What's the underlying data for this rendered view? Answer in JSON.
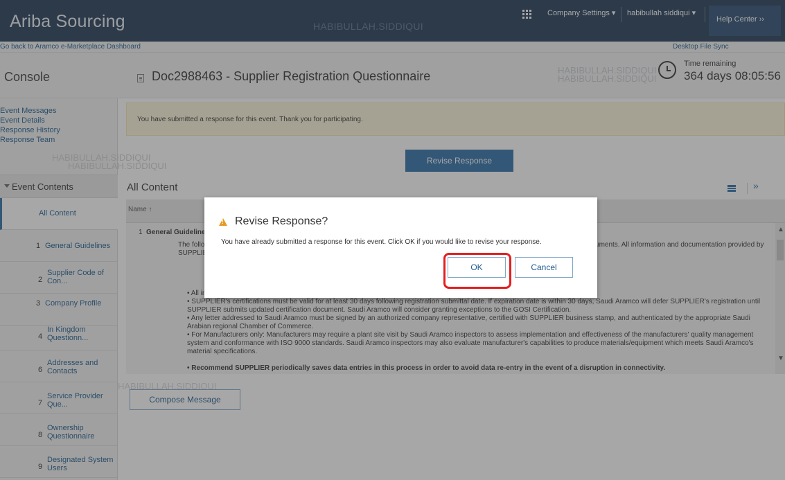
{
  "topbar": {
    "brand": "Ariba Sourcing",
    "watermark": "HABIBULLAH.SIDDIQUI",
    "company_settings": "Company Settings ▾",
    "user_menu": "habibullah siddiqui ▾",
    "help_center": "Help Center ››"
  },
  "subbar": {
    "back_link": "Go back to Aramco e-Marketplace Dashboard",
    "desktop_sync": "Desktop File Sync"
  },
  "header": {
    "console": "Console",
    "doc_title": "Doc2988463 - Supplier Registration Questionnaire",
    "watermark": "HABIBULLAH.SIDDIQUI",
    "time_label": "Time remaining",
    "time_value": "364 days 08:05:56"
  },
  "sidebar": {
    "links": [
      "Event Messages",
      "Event Details",
      "Response History",
      "Response Team"
    ],
    "watermark": "HABIBULLAH.SIDDIQUI",
    "event_contents": "Event Contents",
    "items": [
      {
        "num": "",
        "label": "All Content"
      },
      {
        "num": "1",
        "label": "General Guidelines"
      },
      {
        "num": "2",
        "label": "Supplier Code of Con..."
      },
      {
        "num": "3",
        "label": "Company Profile"
      },
      {
        "num": "4",
        "label": "In Kingdom Questionn..."
      },
      {
        "num": "6",
        "label": "Addresses and Contacts"
      },
      {
        "num": "7",
        "label": "Service Provider Que..."
      },
      {
        "num": "8",
        "label": "Ownership Questionnaire"
      },
      {
        "num": "9",
        "label": "Designated System Users"
      }
    ]
  },
  "main": {
    "notice": "You have submitted a response for this event.  Thank you for participating.",
    "revise_button": "Revise Response",
    "all_content": "All Content",
    "table_header": "Name ↑",
    "row_num": "1",
    "row_title": "General Guidelines",
    "para1": "The following questionnaire is part of the supplier registration process. Please complete all required fields and submit the supporting documents. All information and documentation provided by SUPPLIER will be reviewed. Before you begin filling this questionnaire, please take note of the following SUPPLIER guidelines:",
    "bullet1": "• All information must be accurate.",
    "bullet2": "• SUPPLIER's certifications must be valid for at least 30 days following registration submittal date. If expiration date is within 30 days, Saudi Aramco will defer SUPPLIER's registration until SUPPLIER submits updated certification document.  Saudi Aramco will consider granting exceptions to the GOSI Certification.",
    "bullet3": "• Any letter addressed to Saudi Aramco must be signed by an authorized company representative, certified with SUPPLIER business stamp, and authenticated by the appropriate Saudi Arabian regional Chamber of Commerce.",
    "bullet4": "• For Manufacturers only:  Manufacturers may require a plant site visit by Saudi Aramco inspectors to assess implementation and effectiveness of the manufacturers' quality management system and conformance with ISO 9000 standards. Saudi Aramco inspectors may also evaluate manufacturer's capabilities to produce materials/equipment which meets Saudi Aramco's material specifications.",
    "bullet5": "• Recommend SUPPLIER periodically saves data entries in this process in order to avoid data re-entry in the event of a disruption in connectivity.",
    "compose_button": "Compose Message",
    "watermark": "HABIBULLAH.SIDDIQUI"
  },
  "dialog": {
    "title": "Revise Response?",
    "message": "You have already submitted a response for this event. Click OK if you would like to revise your response.",
    "ok": "OK",
    "cancel": "Cancel"
  },
  "colors": {
    "topbar": "#1f3956",
    "accent": "#2d6ea8",
    "highlight": "#e41e1e",
    "warning": "#e89b22"
  }
}
